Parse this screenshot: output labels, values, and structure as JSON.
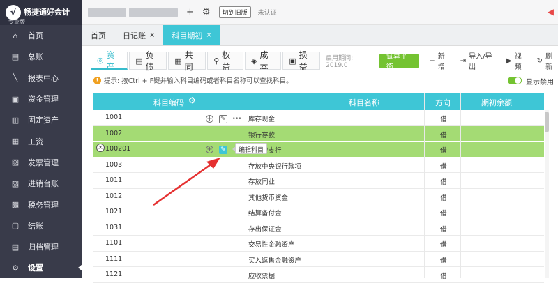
{
  "app": {
    "logo_glyph": "√",
    "name": "畅捷通好会计",
    "edition": "专业版"
  },
  "sidebar": {
    "items": [
      {
        "icon": "⌂",
        "label": "首页"
      },
      {
        "icon": "▤",
        "label": "总账"
      },
      {
        "icon": "╲",
        "label": "报表中心"
      },
      {
        "icon": "▣",
        "label": "资金管理"
      },
      {
        "icon": "▥",
        "label": "固定资产"
      },
      {
        "icon": "▦",
        "label": "工资"
      },
      {
        "icon": "▧",
        "label": "发票管理"
      },
      {
        "icon": "▨",
        "label": "进销台账"
      },
      {
        "icon": "▩",
        "label": "税务管理"
      },
      {
        "icon": "▢",
        "label": "结账"
      },
      {
        "icon": "▤",
        "label": "归档管理"
      },
      {
        "icon": "⚙",
        "label": "设置"
      }
    ]
  },
  "topbar": {
    "add": "+",
    "gear": "⚙",
    "switch_label": "切到旧版",
    "cert_label": "未认证",
    "speaker": "◀"
  },
  "tabs": [
    {
      "label": "首页",
      "closable": false
    },
    {
      "label": "日记账",
      "closable": true
    },
    {
      "label": "科目期初",
      "closable": true
    }
  ],
  "tab_close": "×",
  "categories": [
    {
      "icon": "◎",
      "label": "资产"
    },
    {
      "icon": "▤",
      "label": "负债"
    },
    {
      "icon": "▦",
      "label": "共同"
    },
    {
      "icon": "♀",
      "label": "权益"
    },
    {
      "icon": "◈",
      "label": "成本"
    },
    {
      "icon": "▣",
      "label": "损益"
    }
  ],
  "period": "启用期间: 2019.0",
  "trial_balance": "试算平衡",
  "actions": [
    {
      "icon": "+",
      "label": "新增"
    },
    {
      "icon": "⇥",
      "label": "导入/导出"
    },
    {
      "icon": "▶",
      "label": "视频"
    },
    {
      "icon": "↻",
      "label": "刷新"
    }
  ],
  "tip": {
    "mark": "!",
    "text": "提示: 按Ctrl + F键并输入科目编码或者科目名称可以查找科目。"
  },
  "show_disabled": {
    "label": "显示禁用",
    "on": true
  },
  "table": {
    "headers": {
      "code": "科目编码",
      "name": "科目名称",
      "direction": "方向",
      "opening": "期初余额"
    },
    "rows": [
      {
        "code": "1001",
        "name": "库存现金",
        "dir": "借"
      },
      {
        "code": "1002",
        "name": "银行存款",
        "dir": "借"
      },
      {
        "code": "100201",
        "name": "行平安支行",
        "dir": "借"
      },
      {
        "code": "1003",
        "name": "存放中央银行款项",
        "dir": "借"
      },
      {
        "code": "1011",
        "name": "存放同业",
        "dir": "借"
      },
      {
        "code": "1012",
        "name": "其他货币资金",
        "dir": "借"
      },
      {
        "code": "1021",
        "name": "结算备付金",
        "dir": "借"
      },
      {
        "code": "1031",
        "name": "存出保证金",
        "dir": "借"
      },
      {
        "code": "1101",
        "name": "交易性金融资产",
        "dir": "借"
      },
      {
        "code": "1111",
        "name": "买入返售金融资产",
        "dir": "借"
      },
      {
        "code": "1121",
        "name": "应收票据",
        "dir": "借"
      }
    ]
  },
  "row_ops": {
    "add": "+",
    "edit": "✎",
    "more": "•••",
    "delete": "×"
  },
  "tooltip": "编辑科目",
  "header_gear": "⚙",
  "arrow_color": "#e53030"
}
